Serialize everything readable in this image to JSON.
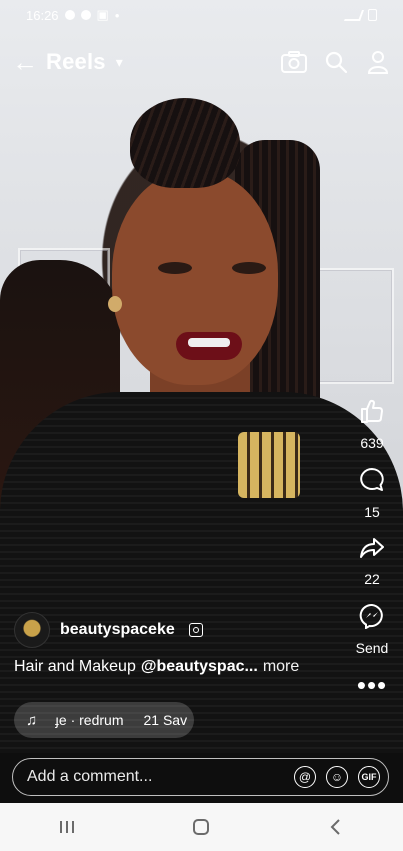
{
  "status_bar": {
    "time": "16:26"
  },
  "top_bar": {
    "title": "Reels"
  },
  "actions": {
    "like_count": "639",
    "comment_count": "15",
    "share_count": "22",
    "send_label": "Send"
  },
  "post": {
    "author": "beautyspaceke",
    "caption_text": "Hair and Makeup",
    "caption_handle": "@beautyspac...",
    "caption_more": "more",
    "audio_text": "  ɟe · redrum",
    "audio_saves": "21 Sav"
  },
  "comment_bar": {
    "placeholder": "Add a comment..."
  },
  "colors": {
    "comment_bar_bg": "#0e0e0e",
    "nav_bar_bg": "#f7f7f7"
  },
  "icons": {
    "status": [
      "sim-icon",
      "shield-icon",
      "image-icon",
      "dot-icon",
      "signal-icon",
      "battery-icon"
    ],
    "top": [
      "back-arrow-icon",
      "chevron-down-icon",
      "camera-icon",
      "search-icon",
      "profile-icon"
    ],
    "actions": [
      "like-icon",
      "comment-icon",
      "share-icon",
      "messenger-icon",
      "more-icon"
    ],
    "comment": [
      "at-icon",
      "emoji-icon",
      "gif-icon"
    ],
    "nav": [
      "recents-icon",
      "home-icon",
      "back-icon"
    ]
  }
}
